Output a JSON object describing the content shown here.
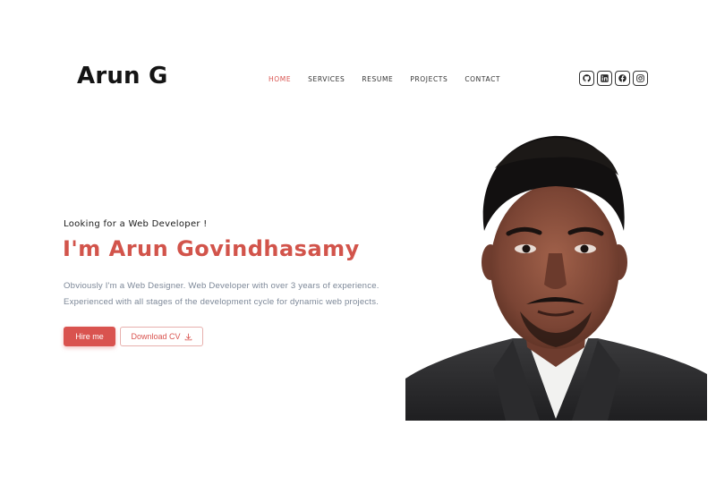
{
  "brand": "Arun G",
  "nav": {
    "items": [
      {
        "label": "HOME",
        "active": true
      },
      {
        "label": "SERVICES",
        "active": false
      },
      {
        "label": "RESUME",
        "active": false
      },
      {
        "label": "PROJECTS",
        "active": false
      },
      {
        "label": "CONTACT",
        "active": false
      }
    ]
  },
  "socials": [
    "github-icon",
    "linkedin-icon",
    "facebook-icon",
    "instagram-icon"
  ],
  "hero": {
    "tagline": "Looking for a Web Developer !",
    "title": "I'm Arun Govindhasamy",
    "description_line1": "Obviously I'm a Web Designer. Web Developer with over 3 years of experience.",
    "description_line2": "Experienced with all stages of the development cycle for dynamic web projects.",
    "hire_label": "Hire me",
    "cv_label": "Download CV"
  },
  "colors": {
    "accent": "#d9534f",
    "text": "#141414",
    "muted": "#7d8898"
  }
}
